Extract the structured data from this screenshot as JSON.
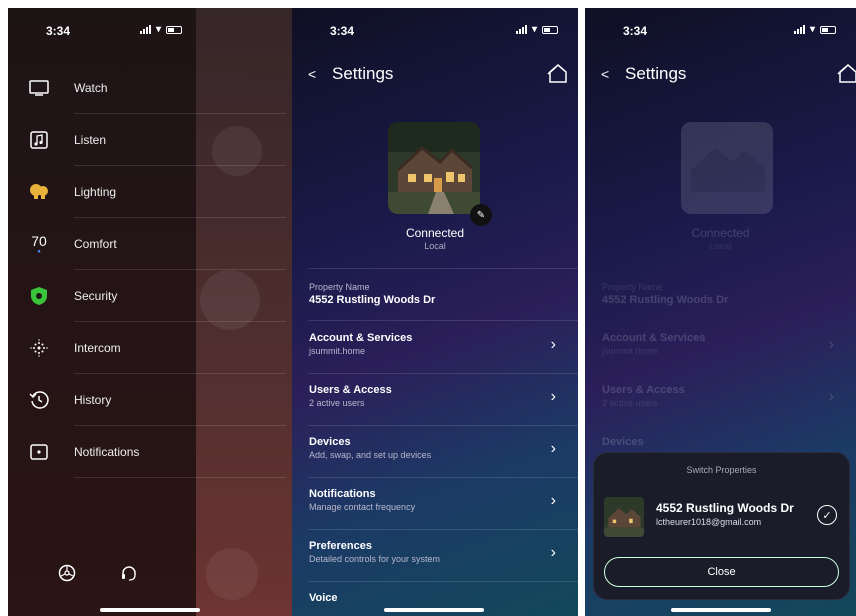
{
  "colors": {
    "security_green": "#39c43a",
    "bulb_yellow": "#e8b33a"
  },
  "menu_panel": {
    "time": "3:34",
    "items": [
      {
        "label": "Watch",
        "icon": "tv-icon"
      },
      {
        "label": "Listen",
        "icon": "music-note-icon"
      },
      {
        "label": "Lighting",
        "icon": "lightbulb-icon"
      },
      {
        "label": "Comfort",
        "icon": "thermostat-icon",
        "value": "70"
      },
      {
        "label": "Security",
        "icon": "shield-icon"
      },
      {
        "label": "Intercom",
        "icon": "intercom-icon"
      },
      {
        "label": "History",
        "icon": "history-icon"
      },
      {
        "label": "Notifications",
        "icon": "notification-icon"
      }
    ],
    "bottom_icons": [
      "settings-wheel-icon",
      "headset-icon"
    ]
  },
  "settings_panel": {
    "time": "3:34",
    "back": "<",
    "title": "Settings",
    "connection": "Connected",
    "connection_sub": "Local",
    "property_label": "Property Name",
    "property_name": "4552 Rustling Woods Dr",
    "rows": [
      {
        "title": "Account & Services",
        "sub": "jsummit.home"
      },
      {
        "title": "Users & Access",
        "sub": "2 active users"
      },
      {
        "title": "Devices",
        "sub": "Add, swap, and set up devices"
      },
      {
        "title": "Notifications",
        "sub": "Manage contact frequency"
      },
      {
        "title": "Preferences",
        "sub": "Detailed controls for your system"
      }
    ],
    "next_row_partial": "Voice"
  },
  "switch_panel": {
    "time": "3:34",
    "back": "<",
    "title": "Settings",
    "dim_connection": "Connected",
    "dim_connection_sub": "Local",
    "dim_property_label": "Property Name",
    "dim_property_name": "4552 Rustling Woods Dr",
    "dim_rows": [
      {
        "title": "Account & Services",
        "sub": "jsummit.home"
      },
      {
        "title": "Users & Access",
        "sub": "2 active users"
      },
      {
        "title": "Devices",
        "sub": ""
      }
    ],
    "sheet_title": "Switch Properties",
    "property_name": "4552 Rustling Woods Dr",
    "property_email": "lctheurer1018@gmail.com",
    "close_label": "Close"
  }
}
